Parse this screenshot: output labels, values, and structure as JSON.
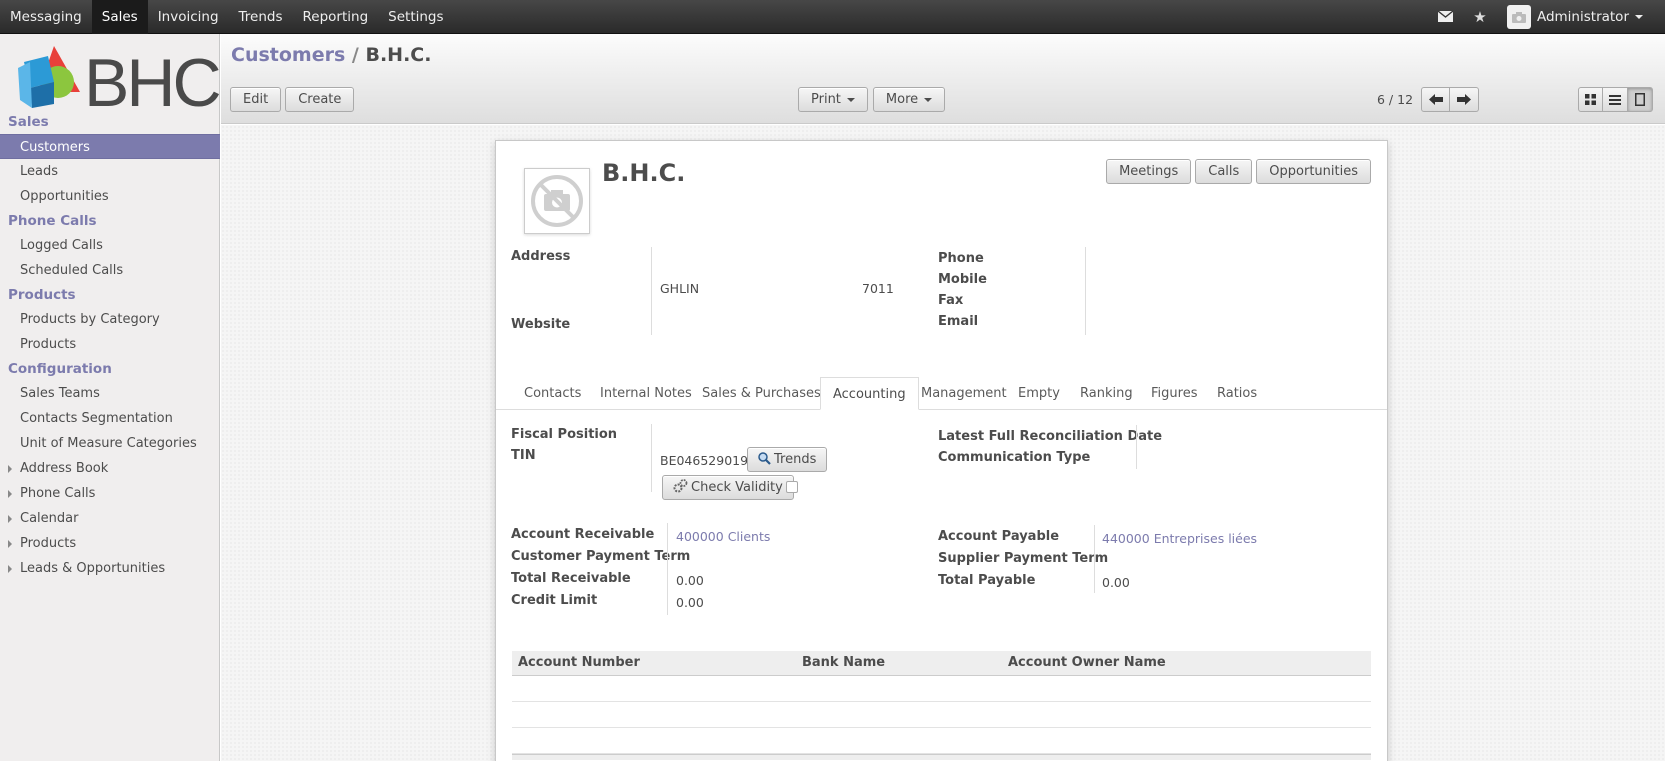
{
  "topbar": {
    "menu": [
      "Messaging",
      "Sales",
      "Invoicing",
      "Trends",
      "Reporting",
      "Settings"
    ],
    "active_index": 1,
    "user": "Administrator"
  },
  "logo": {
    "text": "BHC"
  },
  "sidebar": {
    "sections": [
      {
        "title": "Sales",
        "items": [
          "Customers",
          "Leads",
          "Opportunities"
        ]
      },
      {
        "title": "Phone Calls",
        "items": [
          "Logged Calls",
          "Scheduled Calls"
        ]
      },
      {
        "title": "Products",
        "items": [
          "Products by Category",
          "Products"
        ]
      },
      {
        "title": "Configuration",
        "items": [
          "Sales Teams",
          "Contacts Segmentation",
          "Unit of Measure Categories"
        ]
      }
    ],
    "tree_items": [
      "Address Book",
      "Phone Calls",
      "Calendar",
      "Products",
      "Leads & Opportunities"
    ]
  },
  "breadcrumb": {
    "parent": "Customers",
    "separator": "/",
    "current": "B.H.C."
  },
  "toolbar": {
    "edit": "Edit",
    "create": "Create",
    "print": "Print",
    "more": "More",
    "pager": "6 / 12"
  },
  "record": {
    "name": "B.H.C.",
    "smart_buttons": [
      "Meetings",
      "Calls",
      "Opportunities"
    ],
    "address_label": "Address",
    "city": "GHLIN",
    "zip": "7011",
    "website_label": "Website",
    "phone_label": "Phone",
    "mobile_label": "Mobile",
    "fax_label": "Fax",
    "email_label": "Email"
  },
  "tabs": [
    "Contacts",
    "Internal Notes",
    "Sales & Purchases",
    "Accounting",
    "Management",
    "Empty",
    "Ranking",
    "Figures",
    "Ratios"
  ],
  "active_tab": "Accounting",
  "accounting": {
    "fiscal_position_label": "Fiscal Position",
    "tin_label": "TIN",
    "tin_value": "BE0465290192",
    "trends_button": "Trends",
    "check_validity_button": "Check Validity",
    "latest_reconciliation_label": "Latest Full Reconciliation Date",
    "communication_type_label": "Communication Type",
    "account_receivable_label": "Account Receivable",
    "account_receivable_value": "400000 Clients",
    "customer_payment_term_label": "Customer Payment Term",
    "total_receivable_label": "Total Receivable",
    "total_receivable_value": "0.00",
    "credit_limit_label": "Credit Limit",
    "credit_limit_value": "0.00",
    "account_payable_label": "Account Payable",
    "account_payable_value": "440000 Entreprises liées",
    "supplier_payment_term_label": "Supplier Payment Term",
    "total_payable_label": "Total Payable",
    "total_payable_value": "0.00"
  },
  "bank_table": {
    "columns": [
      "Account Number",
      "Bank Name",
      "Account Owner Name"
    ],
    "rows": []
  },
  "colors": {
    "accent": "#7c7bad",
    "topbar": "#2e2e2e"
  }
}
